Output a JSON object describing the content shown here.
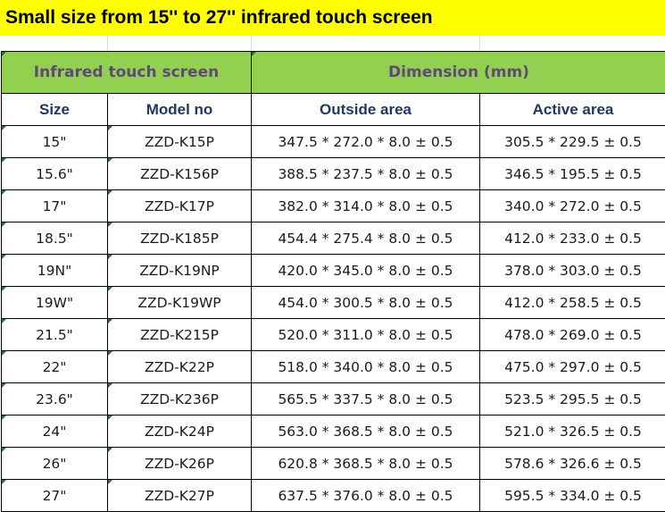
{
  "banner": {
    "title": "Small size from 15'' to 27'' infrared touch screen"
  },
  "table": {
    "group_headers": {
      "left": "Infrared touch screen",
      "right": "Dimension (mm)"
    },
    "columns": [
      "Size",
      "Model no",
      "Outside area",
      "Active area"
    ],
    "rows": [
      {
        "size": "15\"",
        "model": "ZZD-K15P",
        "outside": "347.5 * 272.0 * 8.0 ± 0.5",
        "active": "305.5 * 229.5 ± 0.5"
      },
      {
        "size": "15.6\"",
        "model": "ZZD-K156P",
        "outside": "388.5 * 237.5 * 8.0 ± 0.5",
        "active": "346.5 * 195.5 ± 0.5"
      },
      {
        "size": "17\"",
        "model": "ZZD-K17P",
        "outside": "382.0 * 314.0 * 8.0 ± 0.5",
        "active": "340.0 * 272.0 ± 0.5"
      },
      {
        "size": "18.5\"",
        "model": "ZZD-K185P",
        "outside": "454.4 * 275.4 * 8.0 ± 0.5",
        "active": "412.0 * 233.0 ± 0.5"
      },
      {
        "size": "19N\"",
        "model": "ZZD-K19NP",
        "outside": "420.0 * 345.0 * 8.0 ± 0.5",
        "active": "378.0 * 303.0 ± 0.5"
      },
      {
        "size": "19W\"",
        "model": "ZZD-K19WP",
        "outside": "454.0 * 300.5 * 8.0 ± 0.5",
        "active": "412.0 * 258.5 ± 0.5"
      },
      {
        "size": "21.5\"",
        "model": "ZZD-K215P",
        "outside": "520.0 * 311.0 * 8.0 ± 0.5",
        "active": "478.0 * 269.0 ± 0.5"
      },
      {
        "size": "22\"",
        "model": "ZZD-K22P",
        "outside": "518.0 * 340.0 * 8.0 ± 0.5",
        "active": "475.0 * 297.0 ± 0.5"
      },
      {
        "size": "23.6\"",
        "model": "ZZD-K236P",
        "outside": "565.5 * 337.5 * 8.0 ± 0.5",
        "active": "523.5 * 295.5 ± 0.5"
      },
      {
        "size": "24\"",
        "model": "ZZD-K24P",
        "outside": "563.0 * 368.5 * 8.0 ± 0.5",
        "active": "521.0 * 326.5 ± 0.5"
      },
      {
        "size": "26\"",
        "model": "ZZD-K26P",
        "outside": "620.8 * 368.5 * 8.0 ± 0.5",
        "active": "578.6 * 326.6 ± 0.5"
      },
      {
        "size": "27\"",
        "model": "ZZD-K27P",
        "outside": "637.5 * 376.0 * 8.0 ± 0.5",
        "active": "595.5 * 334.0 ± 0.5"
      }
    ]
  },
  "colors": {
    "banner_bg": "#ffff00",
    "group_header_bg": "#92d050",
    "group_header_text": "#60497a",
    "column_header_text": "#1f3864"
  }
}
